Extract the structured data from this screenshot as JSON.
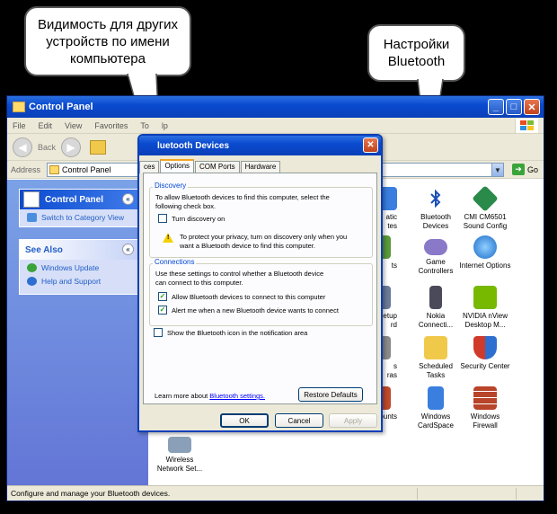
{
  "callouts": {
    "discovery": "Видимость для других устройств по имени компьютера",
    "settings": "Настройки Bluetooth"
  },
  "window": {
    "title": "Control Panel",
    "menu": [
      "File",
      "Edit",
      "View",
      "Favorites",
      "To",
      "lp"
    ],
    "toolbar": {
      "back_label": "Back"
    },
    "address": {
      "label": "Address",
      "value": "Control Panel",
      "go_label": "Go"
    },
    "status": "Configure and manage your Bluetooth devices."
  },
  "sidebar": {
    "panel_title": "Control Panel",
    "switch_link": "Switch to Category View",
    "see_also_title": "See Also",
    "see_also": [
      "Windows Update",
      "Help and Support"
    ]
  },
  "items": {
    "bluetooth": "Bluetooth Devices",
    "cmi": "CMI CM6501 Sound Config",
    "game": "Game Controllers",
    "internet": "Internet Options",
    "nokia": "Nokia Connecti...",
    "nvidia": "NVIDIA nView Desktop M...",
    "scheduled": "Scheduled Tasks",
    "security": "Security Center",
    "cardspace": "Windows CardSpace",
    "firewall": "Windows Firewall",
    "wireless": "Wireless Network Set...",
    "partial": [
      "atic",
      "tes",
      "ts",
      "Setup",
      "rd",
      "s",
      "ras",
      "ounts"
    ]
  },
  "dialog": {
    "title": "luetooth Devices",
    "tabs": [
      "ces",
      "Options",
      "COM Ports",
      "Hardware"
    ],
    "discovery_group": "Discovery",
    "discovery_text": "To allow Bluetooth devices to find this computer, select the following check box.",
    "discovery_checkbox": "Turn discovery on",
    "privacy_text": "To protect your privacy, turn on discovery only when you want a Bluetooth device to find this computer.",
    "connections_group": "Connections",
    "connections_text": "Use these settings to control whether a Bluetooth device can connect to this computer.",
    "allow_checkbox": "Allow Bluetooth devices to connect to this computer",
    "alert_checkbox": "Alert me when a new Bluetooth device wants to connect",
    "show_icon_checkbox": "Show the Bluetooth icon in the notification area",
    "learn_more_prefix": "Learn more about ",
    "learn_more_link": "Bluetooth settings.",
    "restore_button": "Restore Defaults",
    "ok_button": "OK",
    "cancel_button": "Cancel",
    "apply_button": "Apply",
    "states": {
      "discovery": false,
      "allow": true,
      "alert": true,
      "show_icon": false
    }
  },
  "colors": {
    "xp_blue": "#0a4bd0",
    "link": "#215dc6",
    "accent": "#f5a623"
  }
}
